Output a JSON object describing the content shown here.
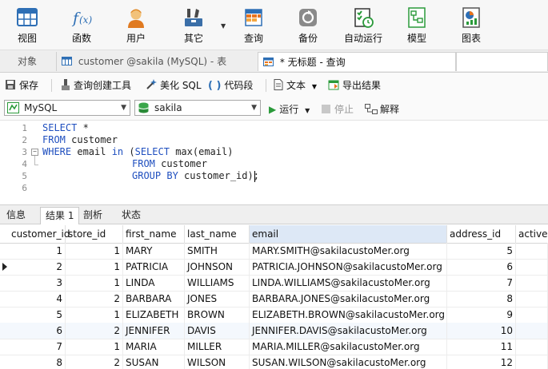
{
  "toolbar": {
    "items": [
      {
        "label": "视图",
        "icon": "table-view-icon"
      },
      {
        "label": "函数",
        "icon": "function-icon"
      },
      {
        "label": "用户",
        "icon": "user-icon"
      },
      {
        "label": "其它",
        "icon": "tools-icon"
      },
      {
        "label": "查询",
        "icon": "query-grid-icon"
      },
      {
        "label": "备份",
        "icon": "backup-icon"
      },
      {
        "label": "自动运行",
        "icon": "schedule-icon"
      },
      {
        "label": "模型",
        "icon": "model-icon"
      },
      {
        "label": "图表",
        "icon": "chart-icon"
      }
    ]
  },
  "tabs": {
    "objects": "对象",
    "customer_table": "customer @sakila (MySQL) - 表",
    "untitled_query": "* 无标题 - 查询"
  },
  "query_toolbar": {
    "save": "保存",
    "query_builder": "查询创建工具",
    "beautify": "美化 SQL",
    "snippet": "代码段",
    "text": "文本",
    "export": "导出结果"
  },
  "connection": {
    "server": "MySQL",
    "database": "sakila",
    "run": "运行",
    "stop": "停止",
    "explain": "解释"
  },
  "editor": {
    "line_numbers": [
      "1",
      "2",
      "3",
      "4",
      "5",
      "6"
    ],
    "lines": [
      {
        "kw": "SELECT",
        "rest": " *"
      },
      {
        "kw": "FROM",
        "rest": " customer"
      },
      {
        "kw": "WHERE",
        "rest": " email ",
        "kw2": "in",
        "rest2": " (",
        "kw3": "SELECT",
        "rest3": " max(email)"
      },
      {
        "kw": "FROM",
        "rest": " customer"
      },
      {
        "kw": "GROUP BY",
        "rest": " customer_id);"
      },
      {
        "kw": "",
        "rest": ""
      }
    ]
  },
  "result_tabs": [
    "信息",
    "结果 1",
    "剖析",
    "状态"
  ],
  "grid": {
    "columns": [
      "customer_id",
      "store_id",
      "first_name",
      "last_name",
      "email",
      "address_id",
      "active"
    ],
    "rows": [
      [
        "1",
        "1",
        "MARY",
        "SMITH",
        "MARY.SMITH@sakilacustoMer.org",
        "5",
        ""
      ],
      [
        "2",
        "1",
        "PATRICIA",
        "JOHNSON",
        "PATRICIA.JOHNSON@sakilacustoMer.org",
        "6",
        ""
      ],
      [
        "3",
        "1",
        "LINDA",
        "WILLIAMS",
        "LINDA.WILLIAMS@sakilacustoMer.org",
        "7",
        ""
      ],
      [
        "4",
        "2",
        "BARBARA",
        "JONES",
        "BARBARA.JONES@sakilacustoMer.org",
        "8",
        ""
      ],
      [
        "5",
        "1",
        "ELIZABETH",
        "BROWN",
        "ELIZABETH.BROWN@sakilacustoMer.org",
        "9",
        ""
      ],
      [
        "6",
        "2",
        "JENNIFER",
        "DAVIS",
        "JENNIFER.DAVIS@sakilacustoMer.org",
        "10",
        ""
      ],
      [
        "7",
        "1",
        "MARIA",
        "MILLER",
        "MARIA.MILLER@sakilacustoMer.org",
        "11",
        ""
      ],
      [
        "8",
        "2",
        "SUSAN",
        "WILSON",
        "SUSAN.WILSON@sakilacustoMer.org",
        "12",
        ""
      ]
    ]
  }
}
